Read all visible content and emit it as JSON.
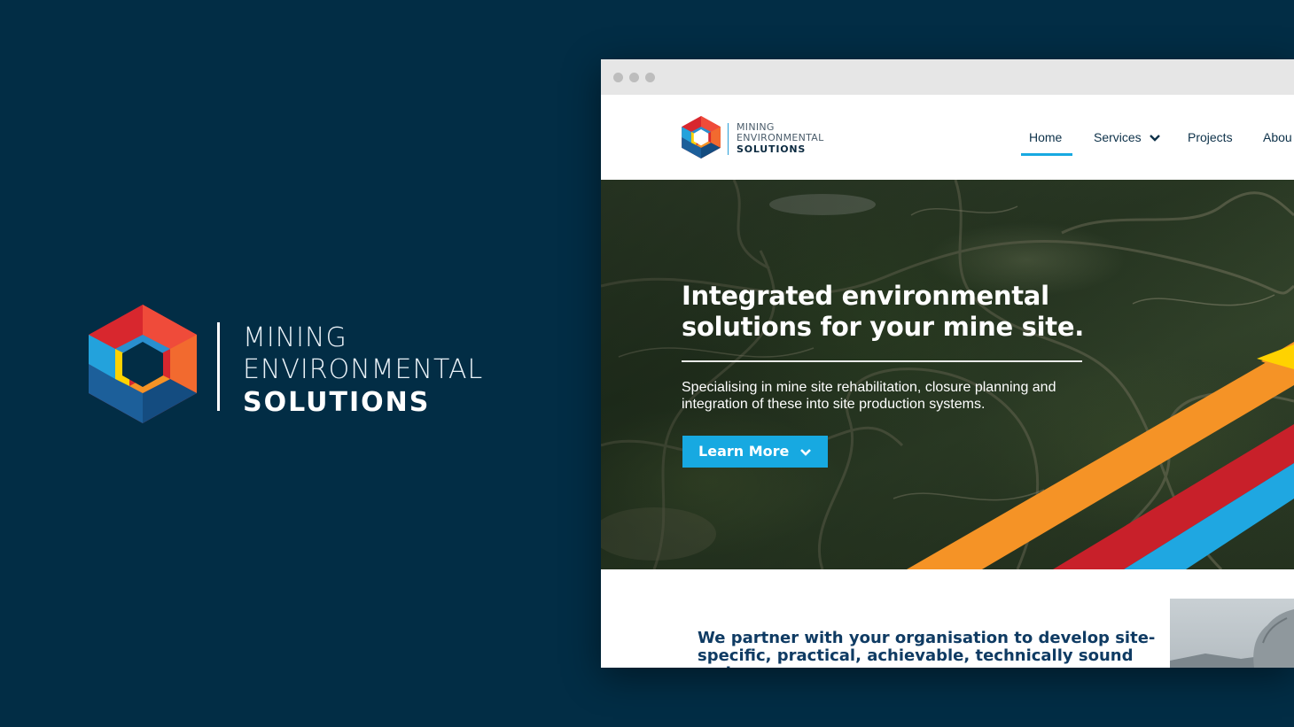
{
  "brand": {
    "line1": "MINING",
    "line2": "ENVIRONMENTAL",
    "line3": "SOLUTIONS",
    "logo_icon": "hexagon-logo-icon"
  },
  "browser": {
    "window_dots": [
      "close",
      "minimize",
      "maximize"
    ]
  },
  "site": {
    "logo": {
      "line1": "MINING",
      "line2": "ENVIRONMENTAL",
      "line3": "SOLUTIONS"
    },
    "nav": {
      "home": "Home",
      "services": "Services",
      "projects": "Projects",
      "about": "Abou",
      "active": "Home"
    },
    "hero": {
      "title_line1": "Integrated environmental",
      "title_line2": "solutions for your mine site.",
      "subtitle_line1": "Specialising in mine site rehabilitation, closure planning and",
      "subtitle_line2": "integration of these into site production systems.",
      "button_label": "Learn More"
    },
    "intro": {
      "line1": "We partner with your organisation to develop site-",
      "line2": "specific, practical, achievable, technically sound and"
    }
  },
  "colors": {
    "background": "#022d45",
    "accent_blue": "#17a9e1",
    "stripe_orange": "#f59326",
    "stripe_red": "#c8202a",
    "stripe_yellow": "#ffd200",
    "intro_text": "#0f3b63"
  }
}
